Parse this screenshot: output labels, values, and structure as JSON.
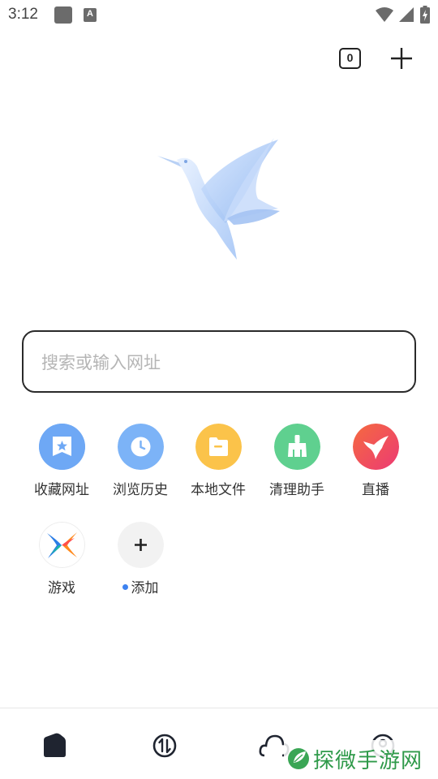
{
  "status_bar": {
    "time": "3:12",
    "notification_icon_letter": "A",
    "icons": [
      "notification-square-icon",
      "font-app-icon",
      "wifi-icon",
      "signal-icon",
      "battery-charging-icon"
    ]
  },
  "top_bar": {
    "tab_count": "0",
    "new_tab_icon": "plus-icon"
  },
  "logo": {
    "icon": "hummingbird-logo-icon"
  },
  "search": {
    "placeholder": "搜索或输入网址",
    "value": ""
  },
  "shortcuts": [
    {
      "label": "收藏网址",
      "icon": "bookmark-star-icon",
      "color": "#6ea8f5"
    },
    {
      "label": "浏览历史",
      "icon": "clock-icon",
      "color": "#7cb3f7"
    },
    {
      "label": "本地文件",
      "icon": "folder-icon",
      "color": "#fbc34a"
    },
    {
      "label": "清理助手",
      "icon": "broom-icon",
      "color": "#5fd08f"
    },
    {
      "label": "直播",
      "icon": "bird-live-icon",
      "color": "#f04c5f"
    },
    {
      "label": "游戏",
      "icon": "game-x-icon",
      "color": "#ffffff"
    },
    {
      "label": "添加",
      "icon": "plus-icon",
      "color": "#f2f2f2"
    }
  ],
  "bottom_nav": {
    "items": [
      "home-icon",
      "sync-icon",
      "cloud-icon",
      "account-icon"
    ]
  },
  "watermark": {
    "text": "探微手游网"
  },
  "colors": {
    "accent_dot": "#3d82f0",
    "search_border": "#2a2a2a",
    "placeholder": "#b5b5b5",
    "watermark_green": "#2f9a4a"
  }
}
